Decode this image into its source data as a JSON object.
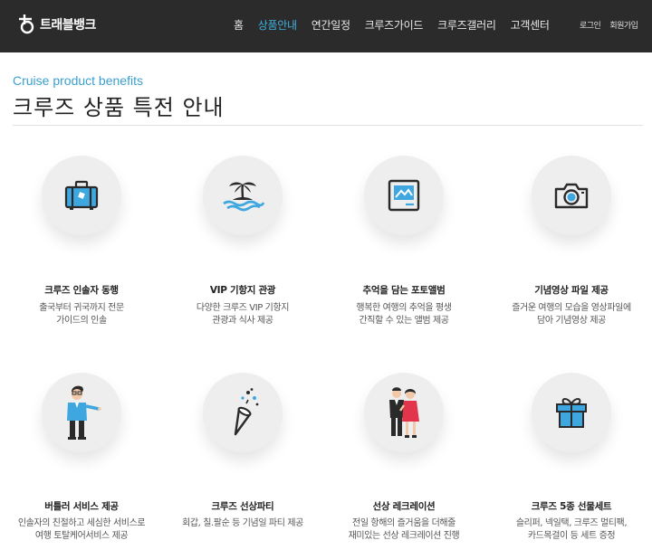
{
  "brand": {
    "name": "트래블뱅크"
  },
  "nav": [
    {
      "label": "홈",
      "active": false
    },
    {
      "label": "상품안내",
      "active": true
    },
    {
      "label": "연간일정",
      "active": false
    },
    {
      "label": "크루즈가이드",
      "active": false
    },
    {
      "label": "크루즈갤러리",
      "active": false
    },
    {
      "label": "고객센터",
      "active": false
    }
  ],
  "account": {
    "login": "로그인",
    "signup": "회원가입"
  },
  "header": {
    "eyebrow": "Cruise product benefits",
    "title": "크루즈 상품 특전 안내"
  },
  "benefits": [
    {
      "icon": "suitcase-icon",
      "title": "크루즈 인솔자 동행",
      "desc": [
        "출국부터 귀국까지 전문",
        "가이드의 인솔"
      ]
    },
    {
      "icon": "palm-island-icon",
      "title": "VIP 기항지 관광",
      "desc": [
        "다양한 크루즈 VIP 기항지",
        "관광과 식사 제공"
      ]
    },
    {
      "icon": "photo-album-icon",
      "title": "추억을 담는 포토앨범",
      "desc": [
        "행복한 여행의 추억을 평생",
        "간직할 수 있는 앨범 제공"
      ]
    },
    {
      "icon": "camera-icon",
      "title": "기념영상 파일 제공",
      "desc": [
        "즐거운 여행의 모습을 영상파일에",
        "담아 기념영상 제공"
      ]
    },
    {
      "icon": "butler-icon",
      "title": "버틀러 서비스 제공",
      "desc": [
        "인솔자의 친절하고 세심한 서비스로",
        "여행 토탈케어서비스 제공"
      ]
    },
    {
      "icon": "party-popper-icon",
      "title": "크루즈 선상파티",
      "desc": [
        "회갑, 칠.팔순 등 기념일 파티 제공"
      ]
    },
    {
      "icon": "couple-icon",
      "title": "선상 레크레이션",
      "desc": [
        "전일 항해의 즐거움을 더해줄",
        "재미있는 선상 레크레이션 진행"
      ]
    },
    {
      "icon": "gift-box-icon",
      "title": "크루즈 5종 선물세트",
      "desc": [
        "슬리퍼, 넥일택, 크루즈 멀티팩,",
        "카드목걸이 등 세트 증정"
      ]
    }
  ],
  "colors": {
    "accent": "#3fb0e0",
    "topbar": "#2b2b2b",
    "icon_blue": "#3fa7e0",
    "icon_dark": "#2a2a2a"
  }
}
